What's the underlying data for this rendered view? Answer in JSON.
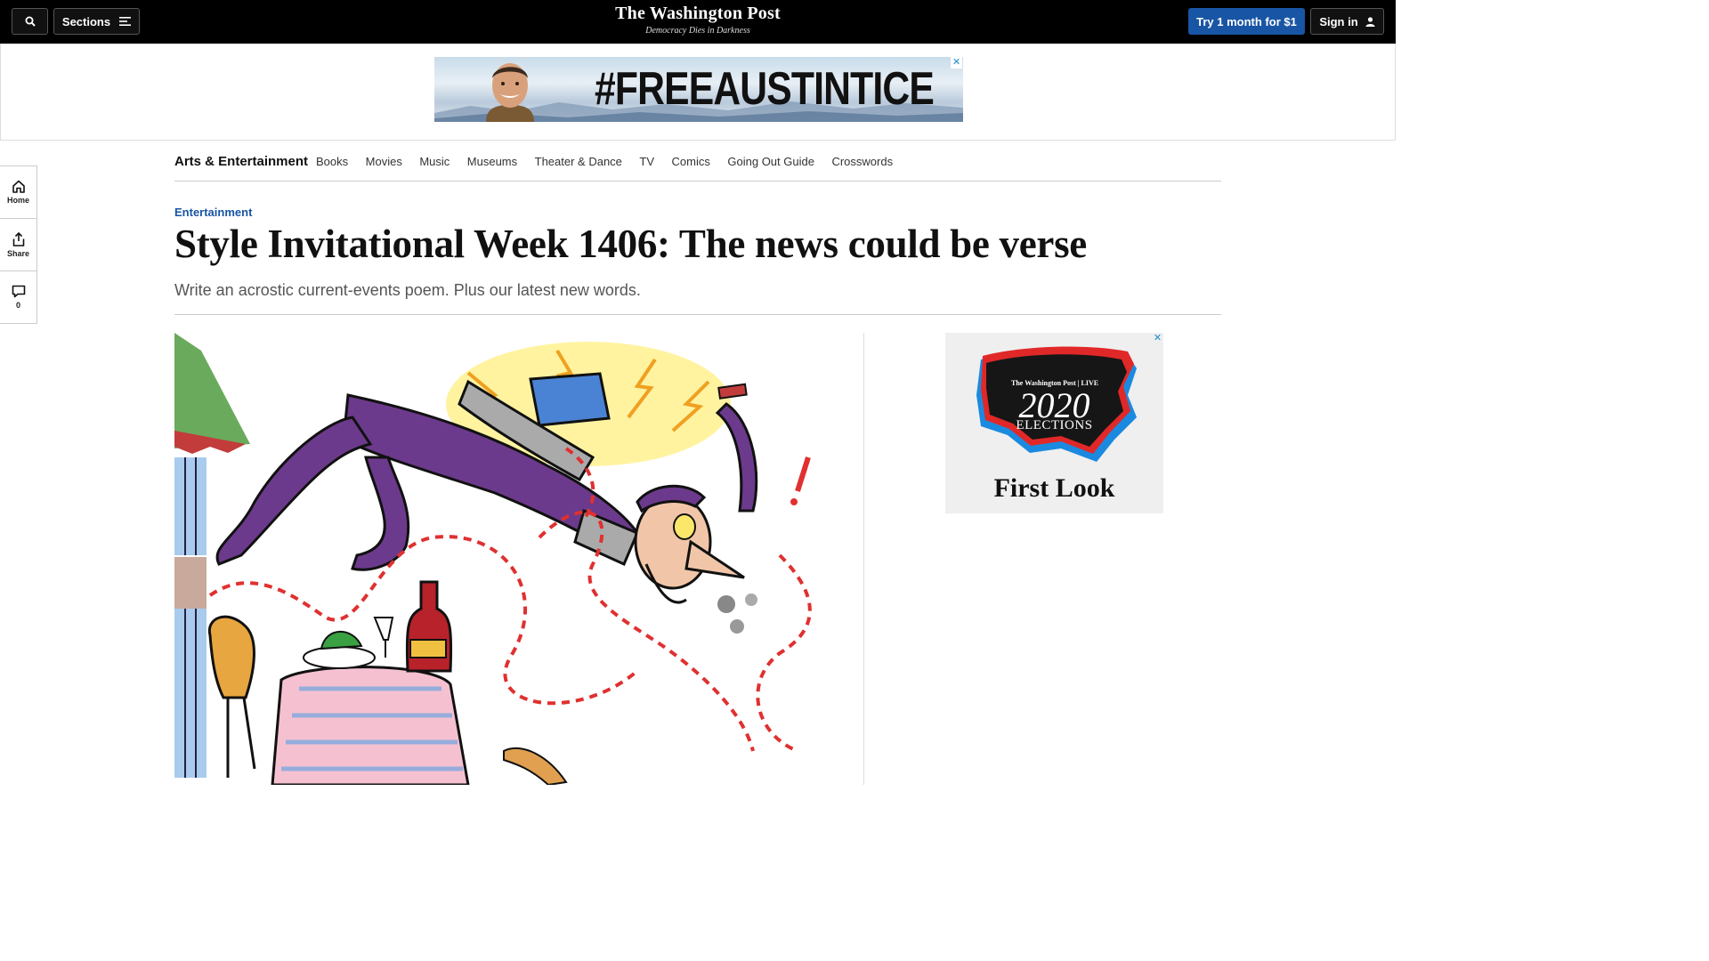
{
  "header": {
    "search_icon": "search-icon",
    "sections_label": "Sections",
    "brand": "The Washington Post",
    "tagline": "Democracy Dies in Darkness",
    "subscribe_label": "Try 1 month for $1",
    "signin_label": "Sign in"
  },
  "top_ad": {
    "text": "#FREEAUSTINTICE",
    "close": "✕"
  },
  "subnav": {
    "section": "Arts & Entertainment",
    "links": [
      "Books",
      "Movies",
      "Music",
      "Museums",
      "Theater & Dance",
      "TV",
      "Comics",
      "Going Out Guide",
      "Crosswords"
    ]
  },
  "rail": {
    "home_label": "Home",
    "share_label": "Share",
    "comments_count": "0"
  },
  "article": {
    "kicker": "Entertainment",
    "headline": "Style Invitational Week 1406: The news could be verse",
    "dek": "Write an acrostic current-events poem. Plus our latest new words."
  },
  "side_ad": {
    "wp_live": "The Washington Post | LIVE",
    "year": "2020",
    "elections": "ELECTIONS",
    "first_look": "First Look",
    "close": "✕"
  },
  "colors": {
    "accent": "#1955a5",
    "topbar": "#000000",
    "ad_close": "#1a8ccf"
  }
}
